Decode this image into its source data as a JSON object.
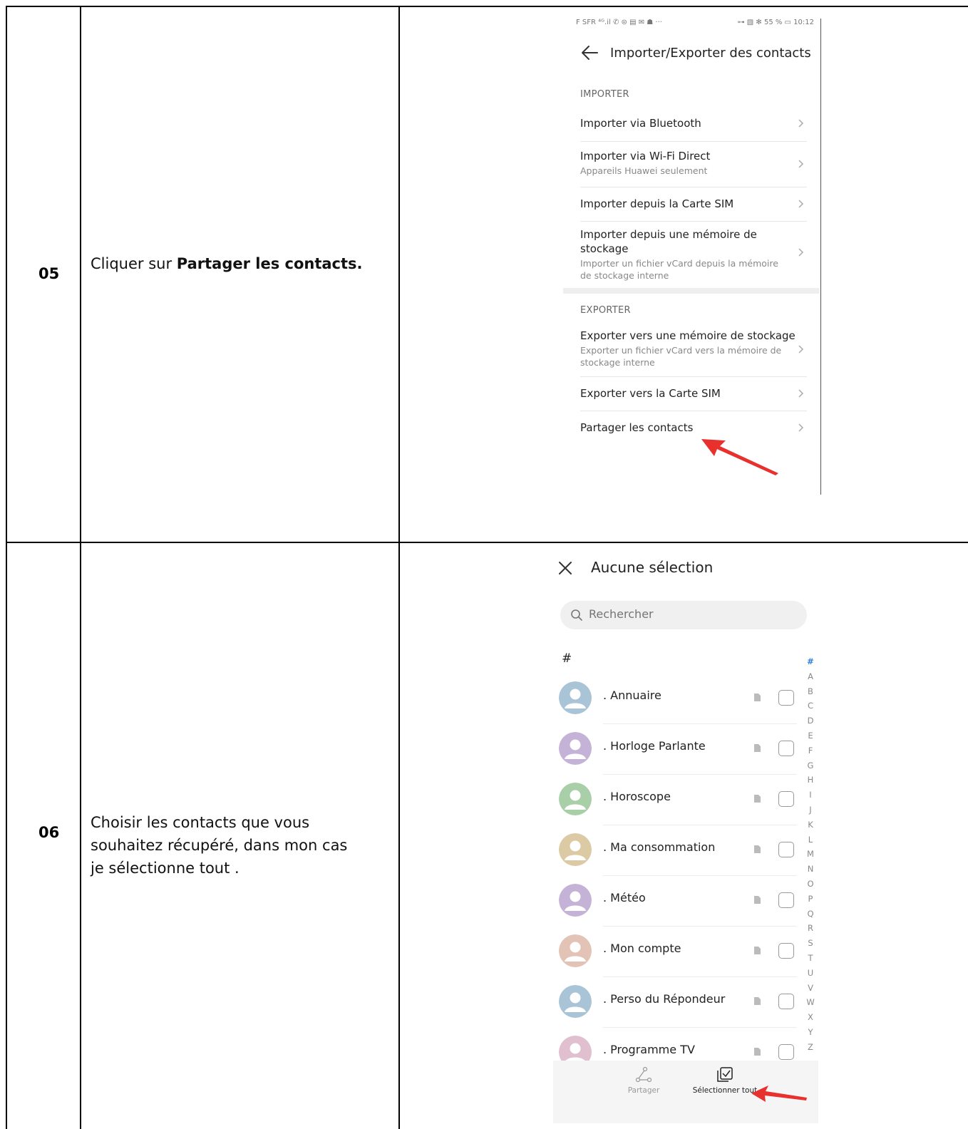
{
  "rows": [
    {
      "step": "05",
      "instruction_prefix": "Cliquer sur ",
      "instruction_bold": "Partager les contacts."
    },
    {
      "step": "06",
      "instruction_lines": [
        "Choisir les contacts que vous",
        "souhaitez récupéré, dans mon cas",
        "je sélectionne tout ."
      ]
    }
  ],
  "phone1": {
    "status_left": "F SFR ⁴ᴳ.il ✆ ⊜ ▤ ✉ ☗ ···",
    "status_right": "⊶ ▧ ✻ 55 % ▭ 10:12",
    "title": "Importer/Exporter des contacts",
    "import_header": "IMPORTER",
    "export_header": "EXPORTER",
    "import_items": [
      {
        "title": "Importer via Bluetooth",
        "subtitle": ""
      },
      {
        "title": "Importer via Wi-Fi Direct",
        "subtitle": "Appareils Huawei seulement"
      },
      {
        "title": "Importer depuis la Carte SIM",
        "subtitle": ""
      },
      {
        "title": "Importer depuis une mémoire de stockage",
        "subtitle": "Importer un fichier vCard depuis la mémoire de stockage interne"
      }
    ],
    "export_items": [
      {
        "title": "Exporter vers une mémoire de stockage",
        "subtitle": "Exporter un fichier vCard vers la mémoire de stockage interne"
      },
      {
        "title": "Exporter vers la Carte SIM",
        "subtitle": ""
      },
      {
        "title": "Partager les contacts",
        "subtitle": ""
      }
    ]
  },
  "phone2": {
    "title": "Aucune sélection",
    "search_placeholder": "Rechercher",
    "group_header": "#",
    "contacts": [
      {
        "name": ". Annuaire",
        "avatar_color": "#a9c4d6"
      },
      {
        "name": ". Horloge Parlante",
        "avatar_color": "#c4b3d6"
      },
      {
        "name": ". Horoscope",
        "avatar_color": "#a9cfa9"
      },
      {
        "name": ". Ma consommation",
        "avatar_color": "#dccaa4"
      },
      {
        "name": ". Météo",
        "avatar_color": "#c4b3d6"
      },
      {
        "name": ". Mon compte",
        "avatar_color": "#e3c3b6"
      },
      {
        "name": ". Perso du Répondeur",
        "avatar_color": "#a9c4d6"
      },
      {
        "name": ". Programme TV",
        "avatar_color": "#e0c0ce"
      }
    ],
    "alpha_index": [
      "#",
      "A",
      "B",
      "C",
      "D",
      "E",
      "F",
      "G",
      "H",
      "I",
      "J",
      "K",
      "L",
      "M",
      "N",
      "O",
      "P",
      "Q",
      "R",
      "S",
      "T",
      "U",
      "V",
      "W",
      "X",
      "Y",
      "Z"
    ],
    "bottom": {
      "share_label": "Partager",
      "select_all_label": "Sélectionner tout"
    }
  },
  "colors": {
    "arrow_red": "#e8302c",
    "index_active": "#2a7de1"
  }
}
